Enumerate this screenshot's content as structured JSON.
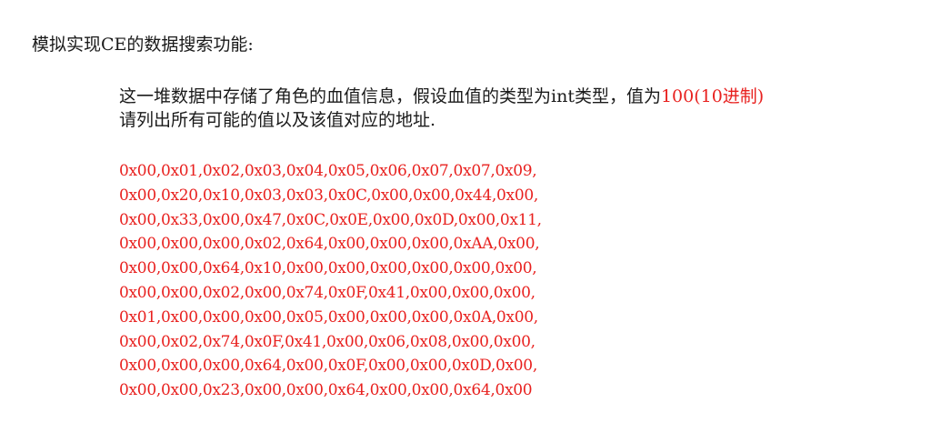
{
  "heading": "模拟实现CE的数据搜索功能:",
  "description": {
    "line1_text": "这一堆数据中存储了角色的血值信息，假设血值的类型为int类型，值为",
    "line1_value": "100(10进制)",
    "line2": "请列出所有可能的值以及该值对应的地址."
  },
  "hex_rows": [
    "0x00,0x01,0x02,0x03,0x04,0x05,0x06,0x07,0x07,0x09,",
    "0x00,0x20,0x10,0x03,0x03,0x0C,0x00,0x00,0x44,0x00,",
    "0x00,0x33,0x00,0x47,0x0C,0x0E,0x00,0x0D,0x00,0x11,",
    "0x00,0x00,0x00,0x02,0x64,0x00,0x00,0x00,0xAA,0x00,",
    "0x00,0x00,0x64,0x10,0x00,0x00,0x00,0x00,0x00,0x00,",
    "0x00,0x00,0x02,0x00,0x74,0x0F,0x41,0x00,0x00,0x00,",
    "0x01,0x00,0x00,0x00,0x05,0x00,0x00,0x00,0x0A,0x00,",
    "0x00,0x02,0x74,0x0F,0x41,0x00,0x06,0x08,0x00,0x00,",
    "0x00,0x00,0x00,0x64,0x00,0x0F,0x00,0x00,0x0D,0x00,",
    "0x00,0x00,0x23,0x00,0x00,0x64,0x00,0x00,0x64,0x00"
  ],
  "colors": {
    "text": "#1a1a1a",
    "highlight": "#e8201e",
    "background": "#ffffff"
  }
}
